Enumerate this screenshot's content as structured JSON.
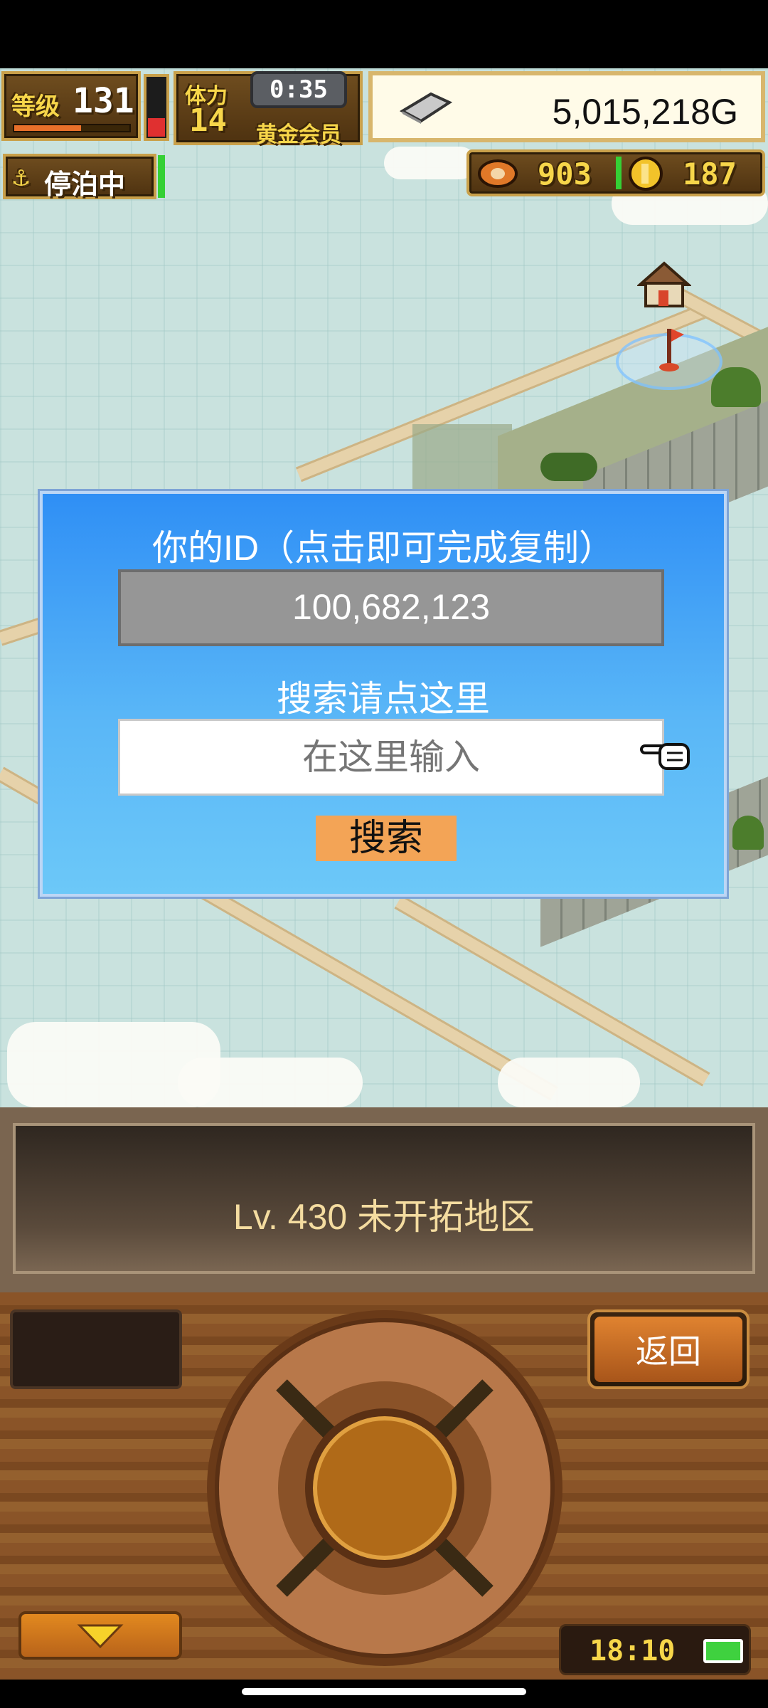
{
  "hud": {
    "level_label": "等级",
    "level_value": "131",
    "stamina_label": "体力",
    "stamina_value": "14",
    "timer": "0:35",
    "membership": "黄金会员",
    "gold": "5,015,218G",
    "docked_status": "停泊中",
    "food_count": "903",
    "coin_count": "187"
  },
  "dialog": {
    "title": "你的ID（点击即可完成复制）",
    "user_id": "100,682,123",
    "search_prompt": "搜索请点这里",
    "search_placeholder": "在这里输入",
    "search_button": "搜索"
  },
  "area": {
    "name": "Lv. 430 未开拓地区"
  },
  "controls": {
    "back_button": "返回",
    "clock": "18:10",
    "battery_color": "#3fd13f"
  },
  "colors": {
    "dialog_blue": "#2f8ff5",
    "search_button": "#f3a456",
    "hud_gold": "#f7d64a"
  }
}
